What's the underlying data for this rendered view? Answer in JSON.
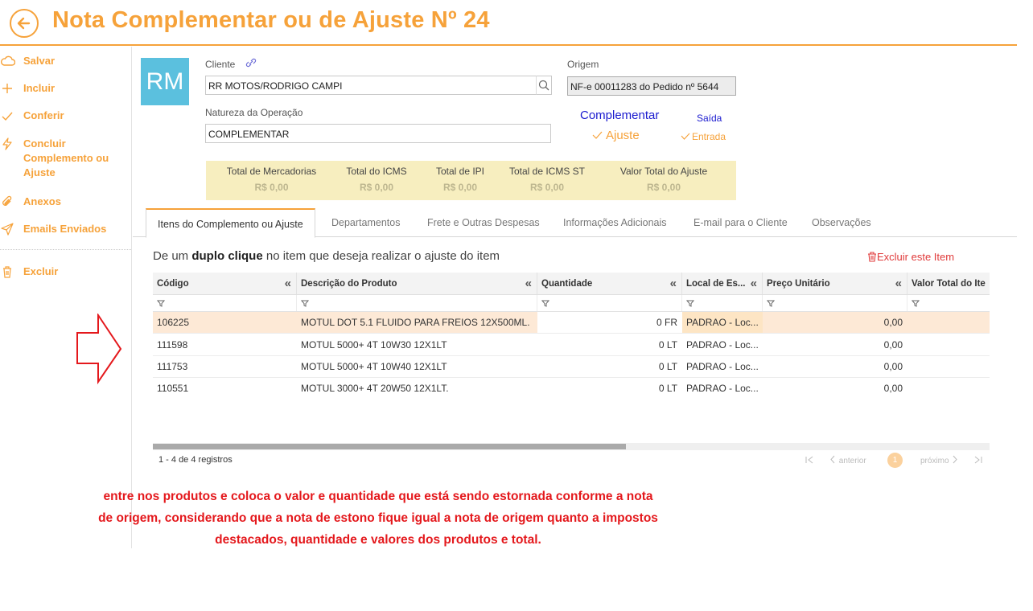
{
  "header": {
    "title": "Nota Complementar ou de Ajuste Nº 24"
  },
  "sidebar": {
    "items": [
      {
        "label": "Salvar",
        "icon": "cloud-icon"
      },
      {
        "label": "Incluir",
        "icon": "plus-icon"
      },
      {
        "label": "Conferir",
        "icon": "check-icon"
      },
      {
        "label": "Concluir Complemento ou Ajuste",
        "icon": "lightning-icon"
      },
      {
        "label": "Anexos",
        "icon": "paperclip-icon"
      },
      {
        "label": "Emails Enviados",
        "icon": "send-icon"
      },
      {
        "label": "Excluir",
        "icon": "trash-icon"
      }
    ]
  },
  "avatar": {
    "initials": "RM"
  },
  "form": {
    "cliente_label": "Cliente",
    "cliente_value": "RR MOTOS/RODRIGO CAMPI",
    "origem_label": "Origem",
    "origem_value": "NF-e 00011283 do Pedido nº 5644",
    "natureza_label": "Natureza da Operação",
    "natureza_value": "COMPLEMENTAR",
    "tipo_complementar": "Complementar",
    "tipo_ajuste": "Ajuste",
    "direcao_saida": "Saída",
    "direcao_entrada": "Entrada"
  },
  "totals": [
    {
      "label": "Total de Mercadorias",
      "value": "R$ 0,00"
    },
    {
      "label": "Total do ICMS",
      "value": "R$ 0,00"
    },
    {
      "label": "Total de IPI",
      "value": "R$ 0,00"
    },
    {
      "label": "Total de ICMS ST",
      "value": "R$ 0,00"
    },
    {
      "label": "Valor Total do Ajuste",
      "value": "R$ 0,00"
    }
  ],
  "tabs": [
    "Itens do Complemento ou Ajuste",
    "Departamentos",
    "Frete e Outras Despesas",
    "Informações Adicionais",
    "E-mail para o Cliente",
    "Observações"
  ],
  "hint": {
    "pre": "De um ",
    "bold": "duplo clique",
    "post": " no item que deseja realizar o ajuste do item"
  },
  "delete_item_label": "Excluir este Item",
  "grid": {
    "columns": [
      "Código",
      "Descrição do Produto",
      "Quantidade",
      "Local de Es...",
      "Preço Unitário",
      "Valor Total do Ite"
    ],
    "collapse_glyph": "«",
    "rows": [
      {
        "codigo": "106225",
        "descricao": "MOTUL DOT 5.1 FLUIDO PARA FREIOS 12X500ML.",
        "quantidade": "0 FR",
        "local": "PADRAO - Loc...",
        "preco": "0,00",
        "total": ""
      },
      {
        "codigo": "111598",
        "descricao": "MOTUL 5000+ 4T 10W30 12X1LT",
        "quantidade": "0 LT",
        "local": "PADRAO - Loc...",
        "preco": "0,00",
        "total": ""
      },
      {
        "codigo": "111753",
        "descricao": "MOTUL 5000+ 4T 10W40 12X1LT",
        "quantidade": "0 LT",
        "local": "PADRAO - Loc...",
        "preco": "0,00",
        "total": ""
      },
      {
        "codigo": "110551",
        "descricao": "MOTUL 3000+ 4T 20W50 12X1LT.",
        "quantidade": "0 LT",
        "local": "PADRAO - Loc...",
        "preco": "0,00",
        "total": ""
      }
    ],
    "records": "1 - 4 de 4 registros",
    "pager": {
      "prev": "anterior",
      "next": "próximo",
      "page": "1"
    }
  },
  "annotation": {
    "text": "entre nos produtos e coloca o valor e quantidade que está sendo estornada conforme a nota de origem, considerando que a nota de estono fique igual a nota de origem quanto a impostos destacados, quantidade e valores dos produtos e total."
  },
  "colors": {
    "accent": "#f6a23a",
    "link": "#1a1acf",
    "annotation": "#e4181c",
    "totals_bg": "#f7eebf"
  }
}
